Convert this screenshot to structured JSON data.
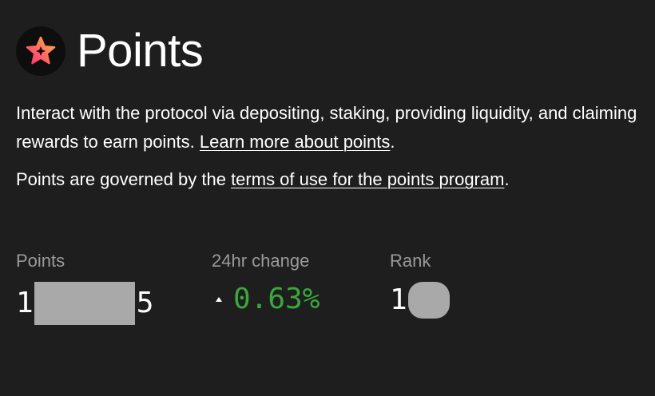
{
  "header": {
    "title": "Points",
    "logo_icon": "star-badge-icon",
    "logo_gradient": [
      "#ff3d6e",
      "#ffb347"
    ]
  },
  "description": {
    "line1_text": "Interact with the protocol via depositing, staking, providing liquidity, and claiming rewards to earn points. ",
    "learn_more_link": "Learn more about points",
    "line1_end": ".",
    "line2_prefix": "Points are governed by the ",
    "terms_link": "terms of use for the points program",
    "line2_end": "."
  },
  "stats": {
    "points": {
      "label": "Points",
      "value_prefix": "1",
      "value_suffix": "5"
    },
    "change": {
      "label": "24hr change",
      "value": "0.63%",
      "direction": "up",
      "color": "#3aa83a"
    },
    "rank": {
      "label": "Rank",
      "value_prefix": "1"
    }
  }
}
